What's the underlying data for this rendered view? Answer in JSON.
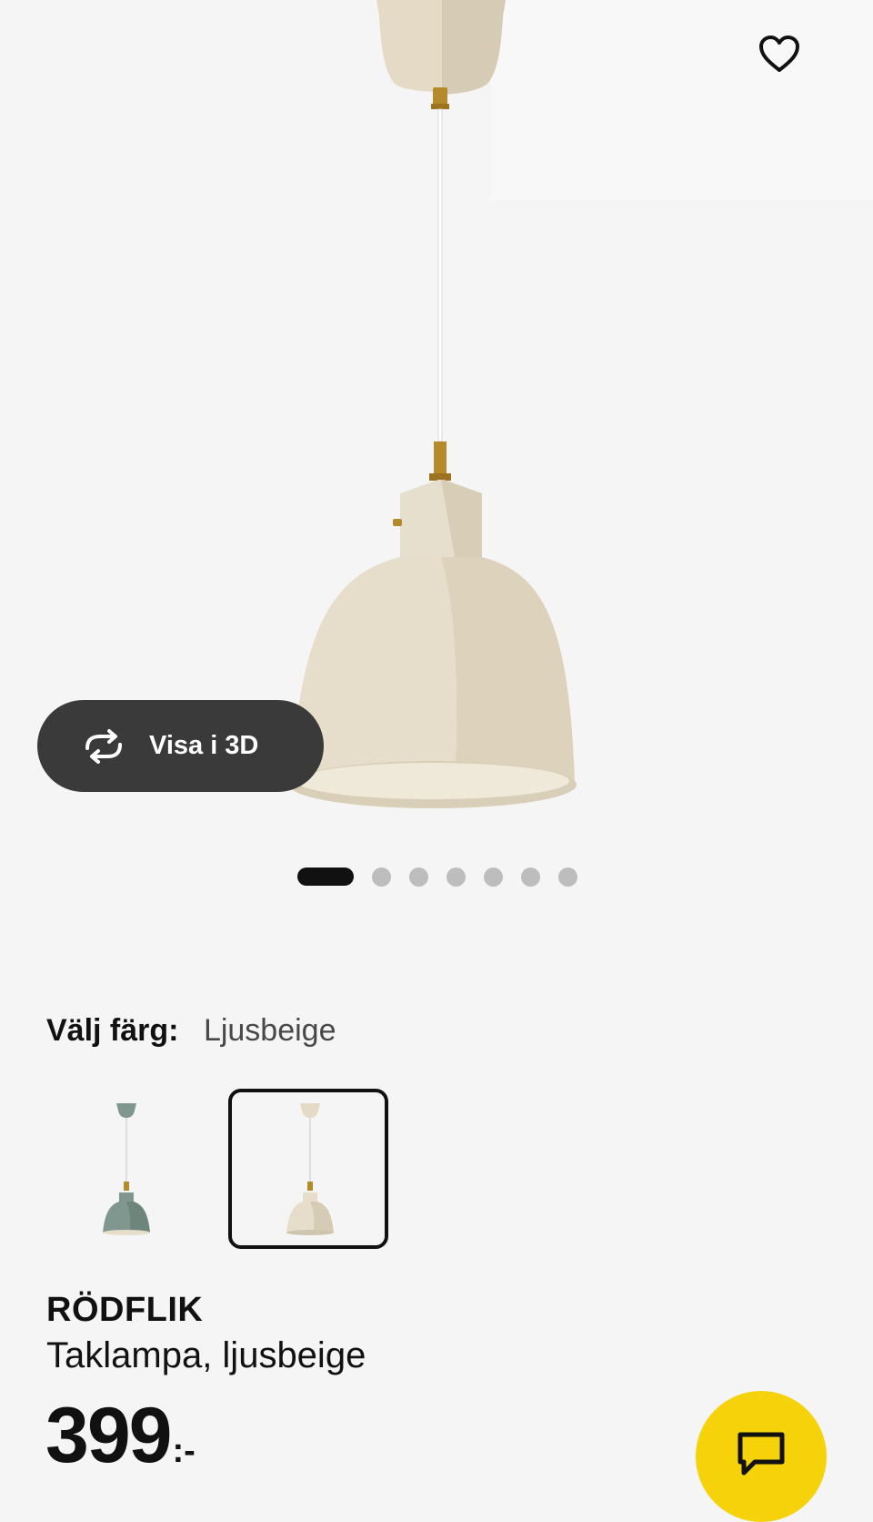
{
  "product": {
    "name": "RÖDFLIK",
    "description": "Taklampa, ljusbeige",
    "price_main": "399",
    "price_suffix": ":-"
  },
  "gallery": {
    "view_3d_label": "Visa i 3D",
    "image_count": 7,
    "active_index": 0
  },
  "color_selector": {
    "label": "Välj färg:",
    "selected_value": "Ljusbeige",
    "options": [
      {
        "color_name": "green",
        "hex": "#7f978e",
        "selected": false
      },
      {
        "color_name": "beige",
        "hex": "#e6ddca",
        "selected": true
      }
    ]
  },
  "icons": {
    "favorite": "heart-icon",
    "rotate": "rotate-3d-icon",
    "chat": "chat-icon"
  },
  "colors": {
    "accent_yellow": "#f5d20a",
    "pill_dark": "#3a3a3a",
    "lamp_beige": "#e6ddca",
    "lamp_brass": "#b58a2a"
  }
}
